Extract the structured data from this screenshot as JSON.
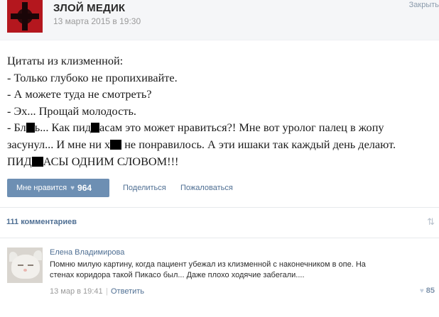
{
  "post": {
    "author": "ЗЛОЙ МЕДИК",
    "date": "13 марта 2015 в 19:30",
    "close_label": "Закрыть",
    "text_lines": [
      "Цитаты из клизменной:",
      "- Только глубоко не пропихивайте.",
      "- А можете туда не смотреть?",
      "- Эх... Прощай молодость."
    ],
    "line5_a": "- Бл",
    "line5_b": "ь... Как пид",
    "line5_c": "асам это может нравиться?! Мне вот уролог палец в жопу",
    "line6_a": "засунул... И мне ни х",
    "line6_b": " не понравилось. А эти ишаки так каждый день делают.",
    "line7_a": "ПИД",
    "line7_b": "АСЫ ОДНИМ СЛОВОМ!!!"
  },
  "actions": {
    "like_label": "Мне нравится",
    "like_count": "964",
    "share_label": "Поделиться",
    "report_label": "Пожаловаться"
  },
  "comments": {
    "count_label": "111 комментариев",
    "items": [
      {
        "author": "Елена Владимирова",
        "text": "Помню милую картину, когда пациент убежал из клизменной с наконечником в опе. На стенах коридора такой Пикасо был... Даже плохо ходячие забегали....",
        "date": "13 мар в 19:41",
        "separator": "|",
        "reply_label": "Ответить",
        "likes": "85"
      }
    ]
  },
  "icons": {
    "heart": "heart-icon",
    "sort": "sort-arrows-icon"
  },
  "colors": {
    "link": "#4f6f93",
    "like_button": "#6d8fb3",
    "redaction": "#000000"
  }
}
